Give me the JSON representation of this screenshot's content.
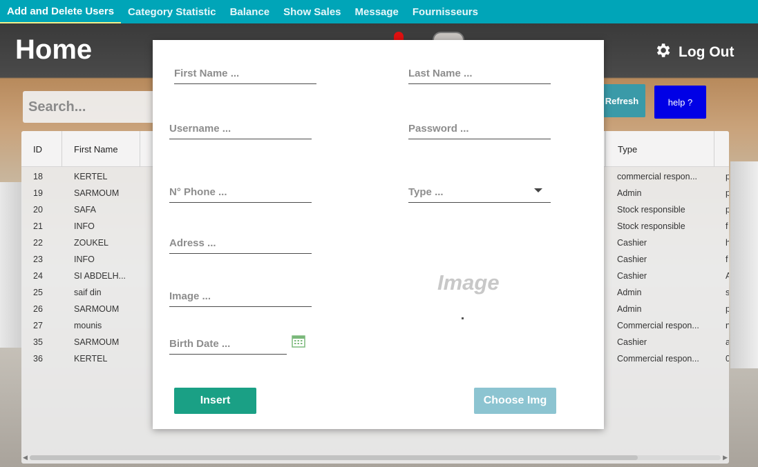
{
  "nav": {
    "tabs": [
      {
        "label": "Add and Delete Users",
        "active": true
      },
      {
        "label": "Category Statistic"
      },
      {
        "label": "Balance"
      },
      {
        "label": "Show Sales"
      },
      {
        "label": "Message"
      },
      {
        "label": "Fournisseurs"
      }
    ]
  },
  "header": {
    "title": "Home",
    "logout_label": "Log Out",
    "logout_icon": "gear-icon"
  },
  "search": {
    "placeholder": "Search..."
  },
  "buttons": {
    "refresh": "Refresh",
    "help": "help ?"
  },
  "table": {
    "columns": [
      "ID",
      "First Name",
      "Type"
    ],
    "rows": [
      {
        "id": "18",
        "first_name": "KERTEL",
        "type": "commercial respon...",
        "extra": "p"
      },
      {
        "id": "19",
        "first_name": "SARMOUM",
        "type": "Admin",
        "extra": "p"
      },
      {
        "id": "20",
        "first_name": "SAFA",
        "type": "Stock responsible",
        "extra": "p"
      },
      {
        "id": "21",
        "first_name": "INFO",
        "type": "Stock responsible",
        "extra": "f"
      },
      {
        "id": "22",
        "first_name": "ZOUKEL",
        "type": "Cashier",
        "extra": "h"
      },
      {
        "id": "23",
        "first_name": "INFO",
        "type": "Cashier",
        "extra": "f"
      },
      {
        "id": "24",
        "first_name": "SI ABDELH...",
        "type": "Cashier",
        "extra": "A"
      },
      {
        "id": "25",
        "first_name": "saif din",
        "type": "Admin",
        "extra": "s"
      },
      {
        "id": "26",
        "first_name": "SARMOUM",
        "type": "Admin",
        "extra": "p"
      },
      {
        "id": "27",
        "first_name": "mounis",
        "type": "Commercial respon...",
        "extra": "n"
      },
      {
        "id": "35",
        "first_name": "SARMOUM",
        "type": "Cashier",
        "extra": "a"
      },
      {
        "id": "36",
        "first_name": "KERTEL",
        "type": "Commercial respon...",
        "extra": "0"
      }
    ]
  },
  "modal": {
    "first_name_placeholder": "First Name ...",
    "last_name_placeholder": "Last Name ...",
    "username_placeholder": "Username ...",
    "password_placeholder": "Password ...",
    "phone_placeholder": "N° Phone ...",
    "type_placeholder": "Type ...",
    "address_placeholder": "Adress ...",
    "image_path_placeholder": "Image ...",
    "birth_date_placeholder": "Birth Date ...",
    "image_preview_label": "Image",
    "insert_label": "Insert",
    "choose_img_label": "Choose Img"
  },
  "colors": {
    "nav_bg": "#00a5b8",
    "insert_btn": "#1aa085",
    "choose_btn": "#8cc4d1",
    "refresh_btn": "#3a9aa8",
    "help_btn": "#0000e6"
  }
}
